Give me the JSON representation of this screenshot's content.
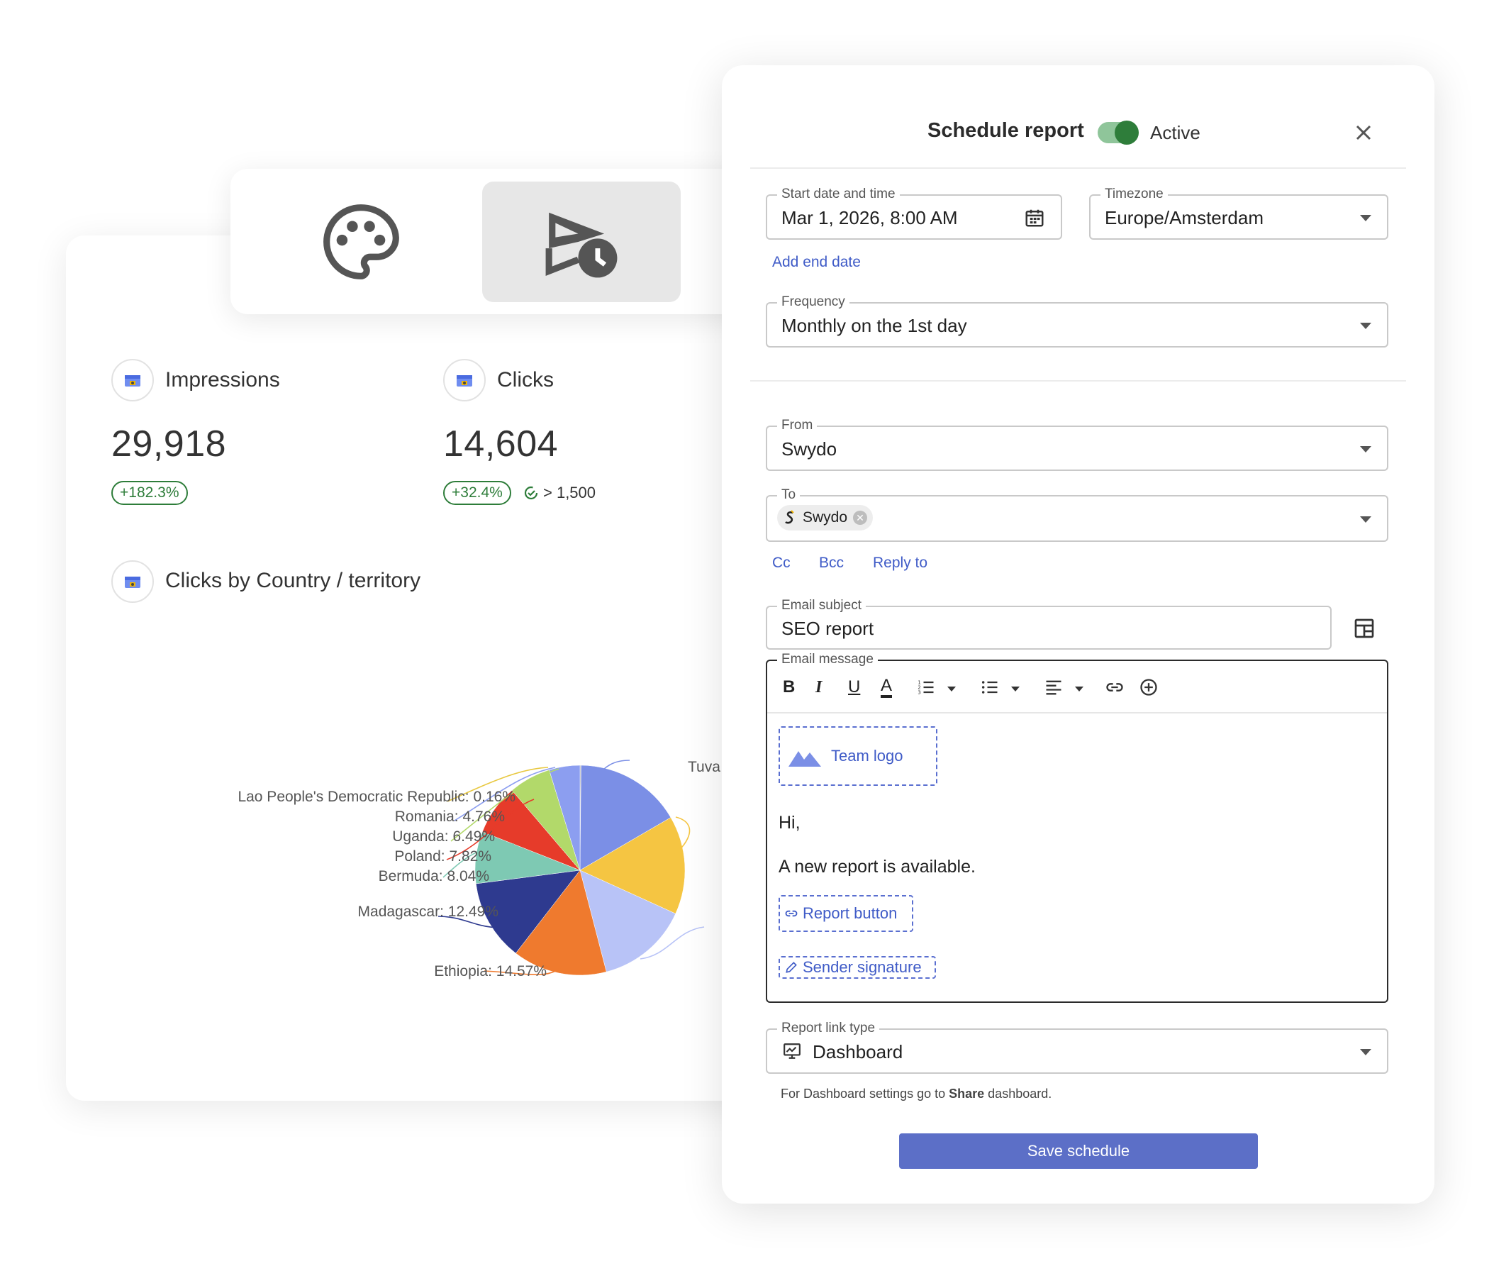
{
  "dashboard": {
    "metrics": [
      {
        "label": "Impressions",
        "value": "29,918",
        "delta": "+182.3%"
      },
      {
        "label": "Clicks",
        "value": "14,604",
        "delta": "+32.4%",
        "goal": "> 1,500"
      }
    ],
    "chart_title": "Clicks by Country / territory"
  },
  "chart_data": {
    "type": "pie",
    "title": "Clicks by Country / territory",
    "slices": [
      {
        "label": "Lao People's Democratic Republic: 0.16%",
        "value": 0.16,
        "color": "#b4b4b4"
      },
      {
        "label": "Tuva",
        "value": 16.5,
        "color": "#7b8fe6"
      },
      {
        "label": "",
        "value": 15.2,
        "color": "#f5c542"
      },
      {
        "label": "",
        "value": 14.2,
        "color": "#b8c3f7"
      },
      {
        "label": "Ethiopia: 14.57%",
        "value": 14.57,
        "color": "#ef7a2e"
      },
      {
        "label": "Madagascar: 12.49%",
        "value": 12.49,
        "color": "#2e3a8f"
      },
      {
        "label": "Bermuda: 8.04%",
        "value": 8.04,
        "color": "#7ec9b3"
      },
      {
        "label": "Poland: 7.82%",
        "value": 7.82,
        "color": "#e63b2a"
      },
      {
        "label": "Uganda: 6.49%",
        "value": 6.49,
        "color": "#b2d96a"
      },
      {
        "label": "Romania: 4.76%",
        "value": 4.76,
        "color": "#8c9ef0"
      }
    ]
  },
  "dialog": {
    "title": "Schedule report",
    "toggle_label": "Active",
    "start": {
      "label": "Start date and time",
      "value": "Mar 1, 2026, 8:00 AM"
    },
    "timezone": {
      "label": "Timezone",
      "value": "Europe/Amsterdam"
    },
    "add_end_date": "Add end date",
    "frequency": {
      "label": "Frequency",
      "value": "Monthly on the 1st day"
    },
    "from": {
      "label": "From",
      "value": "Swydo"
    },
    "to": {
      "label": "To",
      "chip": "Swydo"
    },
    "links": {
      "cc": "Cc",
      "bcc": "Bcc",
      "reply_to": "Reply to"
    },
    "subject": {
      "label": "Email subject",
      "value": "SEO report"
    },
    "message": {
      "label": "Email message",
      "team_logo": "Team logo",
      "greeting": "Hi,",
      "body": "A new report is available.",
      "report_button": "Report button",
      "sender_signature": "Sender signature"
    },
    "link_type": {
      "label": "Report link type",
      "value": "Dashboard"
    },
    "hint_prefix": "For Dashboard settings go to ",
    "hint_bold": "Share",
    "hint_suffix": " dashboard.",
    "save": "Save schedule"
  },
  "colors": {
    "accent": "#5c6fc7",
    "link": "#3f5bc7",
    "toggle_on": "#2e7d3a"
  }
}
